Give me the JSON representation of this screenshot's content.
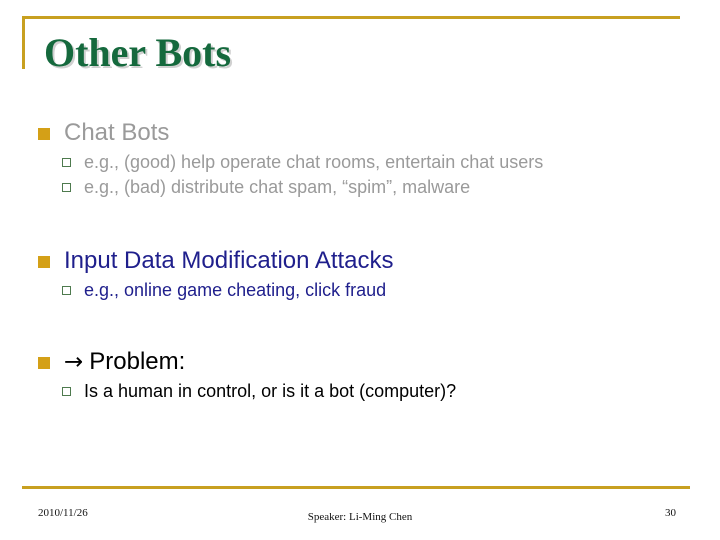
{
  "slide": {
    "title": "Other Bots",
    "accent_gold": "#c8a020",
    "title_color": "#15693d",
    "bullet_gold": "#d4a017",
    "bullet_green": "#4e7a4e",
    "blocks": [
      {
        "heading": "Chat Bots",
        "heading_color": "#9a9a9a",
        "sub_items": [
          "e.g., (good) help operate chat rooms, entertain chat users",
          "e.g., (bad) distribute chat spam, “spim”, malware"
        ]
      },
      {
        "heading": "Input Data Modification Attacks",
        "heading_color": "#1f1f8c",
        "sub_items": [
          "e.g., online game cheating, click fraud"
        ]
      },
      {
        "arrow": "→",
        "heading": "Problem:",
        "heading_color": "#000000",
        "sub_items": [
          "Is a human in control, or is it a bot (computer)?"
        ]
      }
    ]
  },
  "footer": {
    "date": "2010/11/26",
    "speaker": "Speaker: Li-Ming Chen",
    "page_number": "30"
  }
}
